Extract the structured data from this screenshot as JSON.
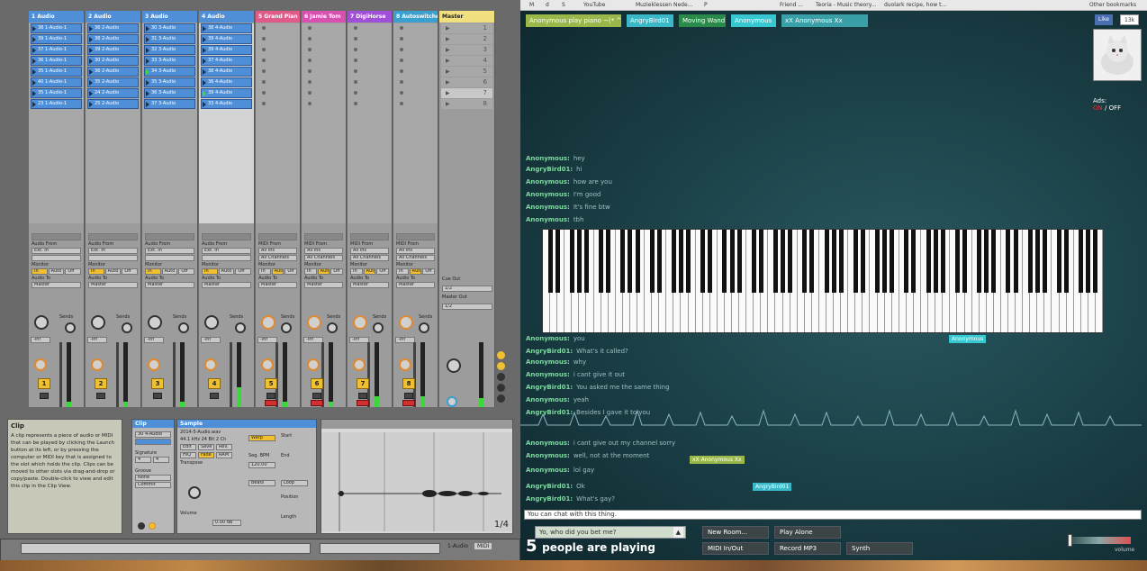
{
  "ableton": {
    "tracks": [
      {
        "name": "1 Audio",
        "color": "#4e8fd8",
        "clips": [
          "38 1-Audio-1",
          "39 1-Audio-1",
          "37 1-Audio-1",
          "36 1-Audio-1",
          "35 1-Audio-1",
          "40 1-Audio-1",
          "35 1-Audio-1",
          "23 1-Audio-1"
        ],
        "playing": -1,
        "vol": "-inf",
        "num": "1",
        "input": "Ext. In",
        "monitor": "In",
        "out": "Master"
      },
      {
        "name": "2 Audio",
        "color": "#4e8fd8",
        "clips": [
          "36 2-Audio",
          "38 2-Audio",
          "39 2-Audio",
          "30 2-Audio",
          "36 2-Audio",
          "35 2-Audio",
          "24 2-Audio",
          "25 2-Audio"
        ],
        "playing": -1,
        "vol": "-inf",
        "num": "2",
        "input": "Ext. In",
        "monitor": "In",
        "out": "Master"
      },
      {
        "name": "3 Audio",
        "color": "#4e8fd8",
        "clips": [
          "30 3-Audio",
          "31 3-Audio",
          "32 3-Audio",
          "33 3-Audio",
          "34 3-Audio",
          "35 3-Audio",
          "36 3-Audio",
          "37 3-Audio"
        ],
        "playing": 4,
        "vol": "-inf",
        "num": "3",
        "input": "Ext. In",
        "monitor": "In",
        "out": "Master"
      },
      {
        "name": "4 Audio",
        "color": "#4e8fd8",
        "clips": [
          "38 4-Audio",
          "39 4-Audio",
          "39 4-Audio",
          "37 4-Audio",
          "38 4-Audio",
          "36 4-Audio",
          "39 4-Audio",
          "33 4-Audio"
        ],
        "playing": 6,
        "vol": "-inf",
        "num": "4",
        "input": "Ext. In",
        "monitor": "In",
        "out": "Master"
      },
      {
        "name": "5 Grand Pian",
        "color": "#e05a8a",
        "clips": [],
        "playing": -1,
        "vol": "-inf",
        "num": "5",
        "input": "All Ins",
        "monitor": "Auto",
        "out": "Master"
      },
      {
        "name": "6 Jamie Tom",
        "color": "#d850b0",
        "clips": [],
        "playing": -1,
        "vol": "-inf",
        "num": "6",
        "input": "All Ins",
        "monitor": "Auto",
        "out": "Master"
      },
      {
        "name": "7 DigiHorse",
        "color": "#a050d8",
        "clips": [],
        "playing": -1,
        "vol": "-inf",
        "num": "7",
        "input": "All Ins",
        "monitor": "Auto",
        "out": "Master"
      },
      {
        "name": "8 Autoswitcher",
        "color": "#3aa0d0",
        "clips": [],
        "playing": -1,
        "vol": "-inf",
        "num": "8",
        "input": "All Ins",
        "monitor": "Auto",
        "out": "Master"
      }
    ],
    "master": {
      "name": "Master",
      "scenes": [
        "1",
        "2",
        "3",
        "4",
        "5",
        "6",
        "7",
        "8"
      ],
      "cue_out": "Cue Out",
      "master_out": "Master Out",
      "cue_val": "1/2",
      "master_val": "1/2"
    },
    "labels": {
      "audio_from": "Audio From",
      "midi_from": "MIDI From",
      "monitor": "Monitor",
      "audio_to": "Audio To",
      "sends": "Sends",
      "in": "In",
      "auto": "Auto",
      "off": "Off",
      "all_channels": "All Channels",
      "post": "Post"
    },
    "info_title": "Clip",
    "info_text": "A clip represents a piece of audio or MIDI that can be played by clicking the Launch button at its left, or by pressing the computer or MIDI key that is assigned to the slot which holds the clip. Clips can be moved to other slots via drag-and-drop or copy/paste. Double-click to view and edit this clip in the Clip View.",
    "clip_panel": {
      "title": "Clip",
      "clip_name": "30 4-Audio",
      "signature": "Signature",
      "sig_vals": [
        "4",
        "4"
      ],
      "groove": "Groove",
      "none": "None",
      "commit": "Commit"
    },
    "sample_panel": {
      "title": "Sample",
      "file": "2014-5-Audio.wav",
      "info": "44.1 kHz 24 Bit 2 Ch",
      "edit": "Edit",
      "save": "Save",
      "rev": "Rev.",
      "warp": "Warp",
      "seg_bpm": "Seg. BPM",
      "bpm": "120.00",
      "hiq": "HiQ",
      "fade": "Fade",
      "ram": "RAM",
      "transpose": "Transpose",
      "volume": "Volume",
      "gain": "0.00 dB",
      "beats": "Beats",
      "start": "Start",
      "end": "End",
      "loop": "Loop",
      "position": "Position",
      "length": "Length"
    },
    "waveform": {
      "counter": "1/4",
      "markers": [
        "1",
        "2",
        "3",
        "4"
      ]
    },
    "bottom_bar": {
      "track_label": "1-Audio",
      "midi_label": "MIDI"
    }
  },
  "browser": {
    "bookmarks": [
      "M",
      "d",
      "S",
      "YouTube",
      "Muzieklessen Nede...",
      "P",
      "Friend ...",
      "Teoria - Music theory...",
      "duolark recipe, how t...",
      "Other bookmarks"
    ]
  },
  "web": {
    "buttons": [
      {
        "label": "Anonymous play piano ~(* ^ *)~",
        "bg": "#9ab84a"
      },
      {
        "label": "AngryBird01",
        "bg": "#3ab8c8"
      },
      {
        "label": "Moving Wand",
        "bg": "#2a8a4a"
      },
      {
        "label": "Anonymous",
        "bg": "#36c8d0"
      },
      {
        "label": "xX Anonymous Xx",
        "bg": "#3aa0a8"
      }
    ],
    "facebook": {
      "like": "Like",
      "count": "13k"
    },
    "ads": {
      "label": "Ads:",
      "on": "ON",
      "sep": " / ",
      "off": "OFF"
    },
    "chat": [
      {
        "name": "Anonymous:",
        "msg": "hey"
      },
      {
        "name": "AngryBird01:",
        "msg": "hi"
      },
      {
        "name": "Anonymous:",
        "msg": "how are you"
      },
      {
        "name": "Anonymous:",
        "msg": "I'm good"
      },
      {
        "name": "Anonymous:",
        "msg": "It's fine btw"
      },
      {
        "name": "Anonymous:",
        "msg": "tbh"
      },
      {
        "name": "Anonymous:",
        "msg": "you"
      },
      {
        "name": "AngryBird01:",
        "msg": "What's it called?"
      },
      {
        "name": "Anonymous:",
        "msg": "why"
      },
      {
        "name": "Anonymous:",
        "msg": "i cant give it out"
      },
      {
        "name": "AngryBird01:",
        "msg": "You asked me the same thing"
      },
      {
        "name": "Anonymous:",
        "msg": "yeah"
      },
      {
        "name": "AngryBird01:",
        "msg": "Besides I gave it to you"
      },
      {
        "name": "Anonymous:",
        "msg": "i cant give out my channel sorry"
      },
      {
        "name": "Anonymous:",
        "msg": "well, not at the moment"
      },
      {
        "name": "Anonymous:",
        "msg": "lol gay"
      },
      {
        "name": "AngryBird01:",
        "msg": "Ok"
      },
      {
        "name": "AngryBird01:",
        "msg": "What's gay?"
      }
    ],
    "cursor_tags": [
      {
        "label": "Anonymous",
        "bg": "#36c8d0"
      },
      {
        "label": "xX Anonymous Xx",
        "bg": "#9ab84a"
      },
      {
        "label": "AngryBird01",
        "bg": "#3ab8c8"
      }
    ],
    "chat_input_placeholder": "You can chat with this thing.",
    "chat_input_value": "Yo, who did you bet me?",
    "players": {
      "count": "5",
      "text": "people are playing"
    },
    "controls": {
      "new_room": "New Room...",
      "play_alone": "Play Alone",
      "midi": "MIDI In/Out",
      "record": "Record MP3",
      "synth": "Synth"
    },
    "volume_label": "volume"
  }
}
